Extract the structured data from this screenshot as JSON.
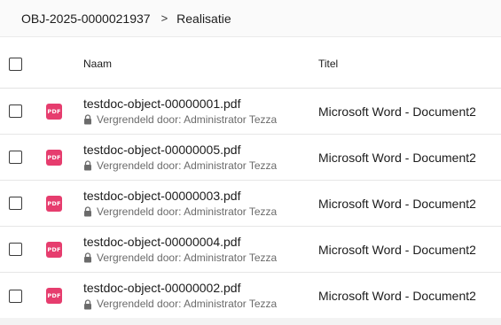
{
  "breadcrumb": {
    "object_id": "OBJ-2025-0000021937",
    "separator": ">",
    "current": "Realisatie"
  },
  "table": {
    "columns": {
      "name": "Naam",
      "title": "Titel"
    },
    "rows": [
      {
        "file": "testdoc-object-00000001.pdf",
        "lock": "Vergrendeld door: Administrator Tezza",
        "title": "Microsoft Word - Document2",
        "icon": "PDF"
      },
      {
        "file": "testdoc-object-00000005.pdf",
        "lock": "Vergrendeld door: Administrator Tezza",
        "title": "Microsoft Word - Document2",
        "icon": "PDF"
      },
      {
        "file": "testdoc-object-00000003.pdf",
        "lock": "Vergrendeld door: Administrator Tezza",
        "title": "Microsoft Word - Document2",
        "icon": "PDF"
      },
      {
        "file": "testdoc-object-00000004.pdf",
        "lock": "Vergrendeld door: Administrator Tezza",
        "title": "Microsoft Word - Document2",
        "icon": "PDF"
      },
      {
        "file": "testdoc-object-00000002.pdf",
        "lock": "Vergrendeld door: Administrator Tezza",
        "title": "Microsoft Word - Document2",
        "icon": "PDF"
      }
    ]
  },
  "colors": {
    "pdf_badge": "#e63d6e",
    "lock_text": "#6b6b6b"
  },
  "icons": {
    "file_type": "pdf-icon",
    "lock": "lock-icon",
    "separator": "chevron-right-icon"
  }
}
